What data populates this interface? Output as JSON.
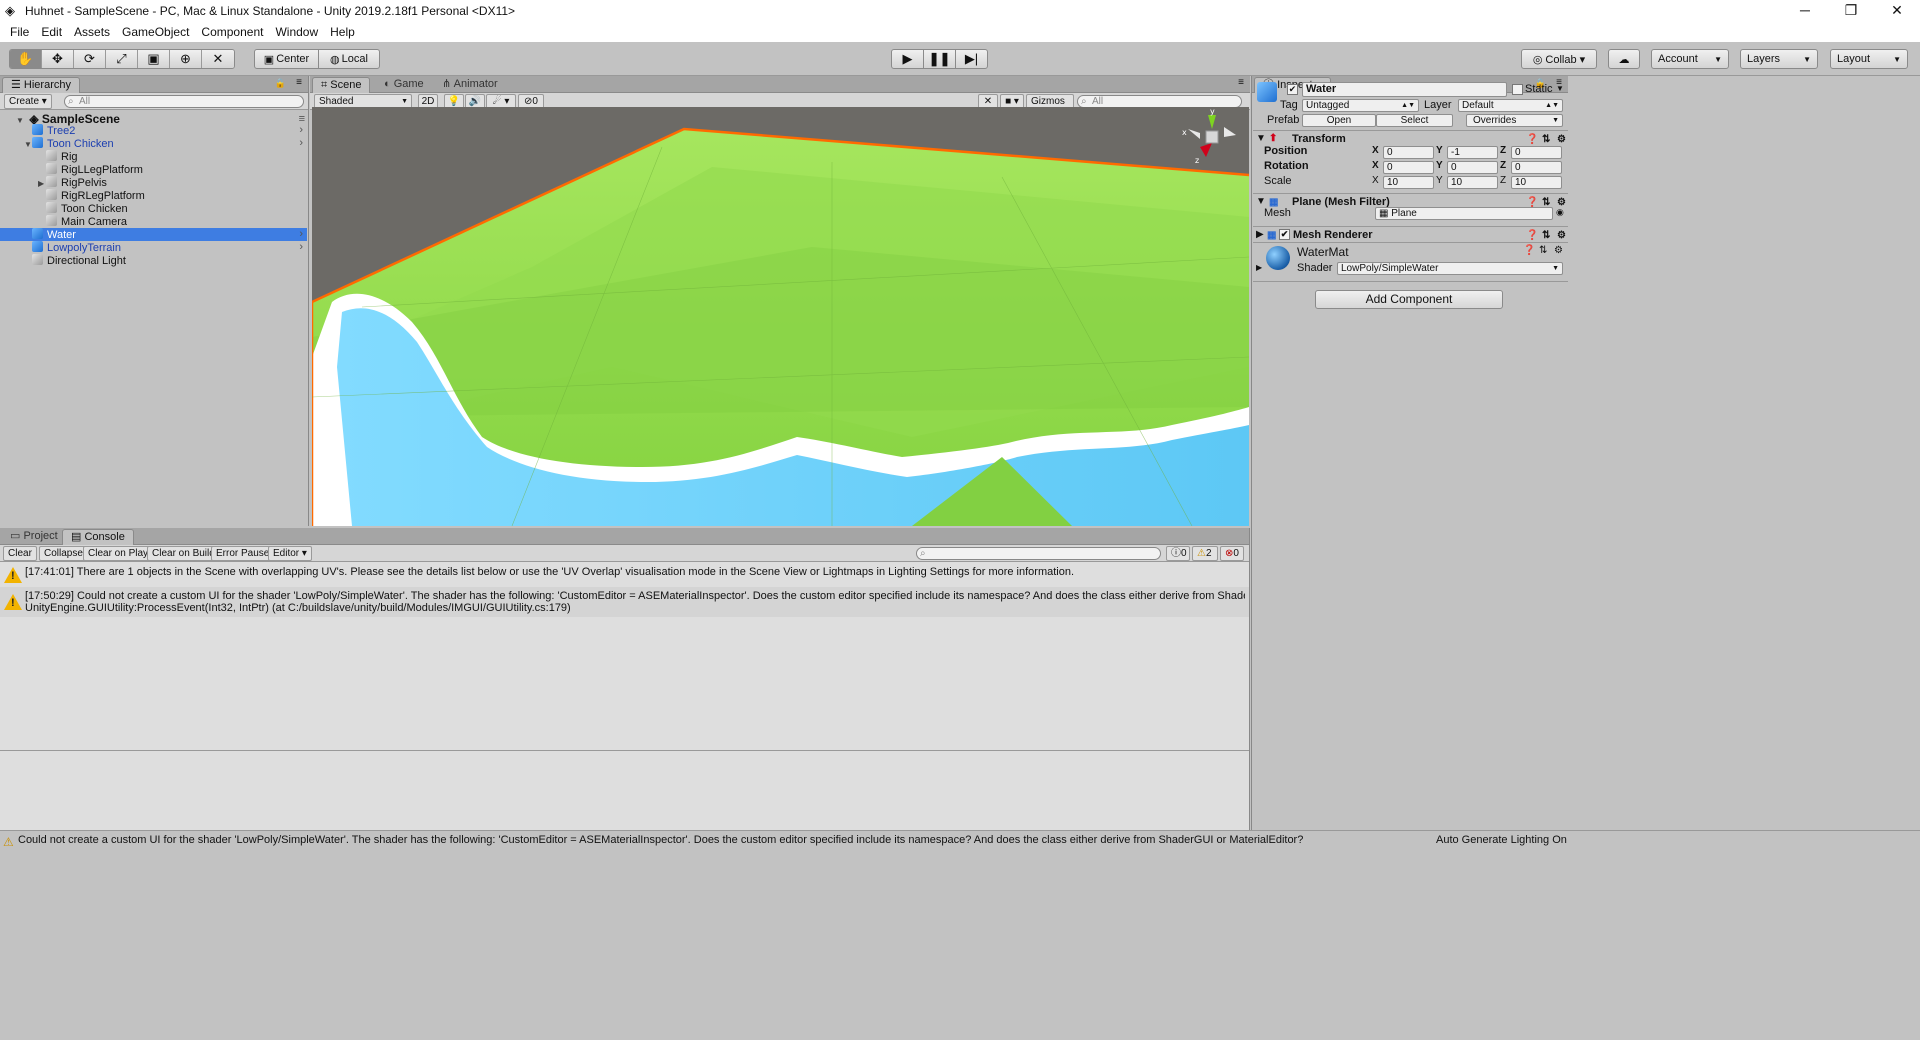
{
  "window": {
    "title": "Huhnet - SampleScene - PC, Mac & Linux Standalone - Unity 2019.2.18f1 Personal <DX11>",
    "controls": {
      "minimize": "─",
      "maximize": "❐",
      "close": "✕"
    }
  },
  "menu": [
    "File",
    "Edit",
    "Assets",
    "GameObject",
    "Component",
    "Window",
    "Help"
  ],
  "toolbar": {
    "tools": [
      "hand-tool",
      "move-tool",
      "rotate-tool",
      "scale-tool",
      "rect-tool",
      "transform-tool",
      "custom-tool"
    ],
    "pivot": "Center",
    "space": "Local",
    "collab": "Collab ▾",
    "account": "Account",
    "layers": "Layers",
    "layout": "Layout"
  },
  "hierarchy": {
    "tab": "Hierarchy",
    "create": "Create ▾",
    "search_placeholder": "All",
    "scene": "SampleScene",
    "items": [
      {
        "label": "Tree2",
        "indent": 1,
        "icon": "blue",
        "prefab": true,
        "chevron": true,
        "arrow": ""
      },
      {
        "label": "Toon Chicken",
        "indent": 1,
        "icon": "blue",
        "prefab": true,
        "chevron": true,
        "arrow": "▼"
      },
      {
        "label": "Rig",
        "indent": 2,
        "icon": "gray",
        "prefab": true,
        "chevron": false,
        "arrow": ""
      },
      {
        "label": "RigLLegPlatform",
        "indent": 2,
        "icon": "gray",
        "prefab": true,
        "chevron": false,
        "arrow": ""
      },
      {
        "label": "RigPelvis",
        "indent": 2,
        "icon": "gray",
        "prefab": true,
        "chevron": false,
        "arrow": "▶"
      },
      {
        "label": "RigRLegPlatform",
        "indent": 2,
        "icon": "gray",
        "prefab": true,
        "chevron": false,
        "arrow": ""
      },
      {
        "label": "Toon Chicken",
        "indent": 2,
        "icon": "gray",
        "prefab": true,
        "chevron": false,
        "arrow": ""
      },
      {
        "label": "Main Camera",
        "indent": 2,
        "icon": "gray",
        "prefab": false,
        "chevron": false,
        "arrow": ""
      },
      {
        "label": "Water",
        "indent": 1,
        "icon": "blue",
        "prefab": true,
        "chevron": true,
        "arrow": "",
        "selected": true
      },
      {
        "label": "LowpolyTerrain",
        "indent": 1,
        "icon": "blue",
        "prefab": true,
        "chevron": true,
        "arrow": ""
      },
      {
        "label": "Directional Light",
        "indent": 1,
        "icon": "gray",
        "prefab": false,
        "chevron": false,
        "arrow": ""
      }
    ]
  },
  "scene": {
    "tabs": [
      "Scene",
      "Game",
      "Animator"
    ],
    "shading": "Shaded",
    "mode2d": "2D",
    "fx_count": "0",
    "gizmos": "Gizmos ▾",
    "search_placeholder": "All",
    "gizmo_axes": {
      "y": "y",
      "x": "x",
      "z": "z"
    }
  },
  "inspector": {
    "tab": "Inspector",
    "name": "Water",
    "static": "Static",
    "tag_label": "Tag",
    "tag_value": "Untagged",
    "layer_label": "Layer",
    "layer_value": "Default",
    "prefab_label": "Prefab",
    "prefab_open": "Open",
    "prefab_select": "Select",
    "prefab_overrides": "Overrides",
    "transform": {
      "title": "Transform",
      "position_label": "Position",
      "position": [
        "0",
        "-1",
        "0"
      ],
      "rotation_label": "Rotation",
      "rotation": [
        "0",
        "0",
        "0"
      ],
      "scale_label": "Scale",
      "scale": [
        "10",
        "10",
        "10"
      ],
      "axes": [
        "X",
        "Y",
        "Z"
      ]
    },
    "mesh_filter": {
      "title": "Plane (Mesh Filter)",
      "mesh_label": "Mesh",
      "mesh_value": "Plane"
    },
    "mesh_renderer": {
      "title": "Mesh Renderer"
    },
    "material": {
      "name": "WaterMat",
      "shader_label": "Shader",
      "shader_value": "LowPoly/SimpleWater"
    },
    "add_component": "Add Component"
  },
  "console": {
    "tabs": [
      "Project",
      "Console"
    ],
    "buttons": [
      "Clear",
      "Collapse",
      "Clear on Play",
      "Clear on Build",
      "Error Pause",
      "Editor ▾"
    ],
    "counts": {
      "log": "0",
      "warn": "2",
      "error": "0"
    },
    "messages": [
      {
        "line1": "[17:41:01] There are 1 objects in the Scene with overlapping UV's. Please see the details list below or use the 'UV Overlap' visualisation mode in the Scene View or Lightmaps in Lighting Settings for more information.",
        "line2": ""
      },
      {
        "line1": "[17:50:29] Could not create a custom UI for the shader 'LowPoly/SimpleWater'. The shader has the following: 'CustomEditor = ASEMaterialInspector'. Does the custom editor specified include its namespace? And does the class either derive from ShaderGUI or M",
        "line2": "UnityEngine.GUIUtility:ProcessEvent(Int32, IntPtr) (at C:/buildslave/unity/build/Modules/IMGUI/GUIUtility.cs:179)"
      }
    ]
  },
  "status": {
    "message": "Could not create a custom UI for the shader 'LowPoly/SimpleWater'. The shader has the following: 'CustomEditor = ASEMaterialInspector'. Does the custom editor specified include its namespace? And does the class either derive from ShaderGUI or MaterialEditor?",
    "right": "Auto Generate Lighting On"
  },
  "colors": {
    "selection": "#3e7de2",
    "grass": "#8fdc4c",
    "water": "#7ad6ff",
    "outline": "#ff6a00",
    "warning": "#f2b300"
  }
}
